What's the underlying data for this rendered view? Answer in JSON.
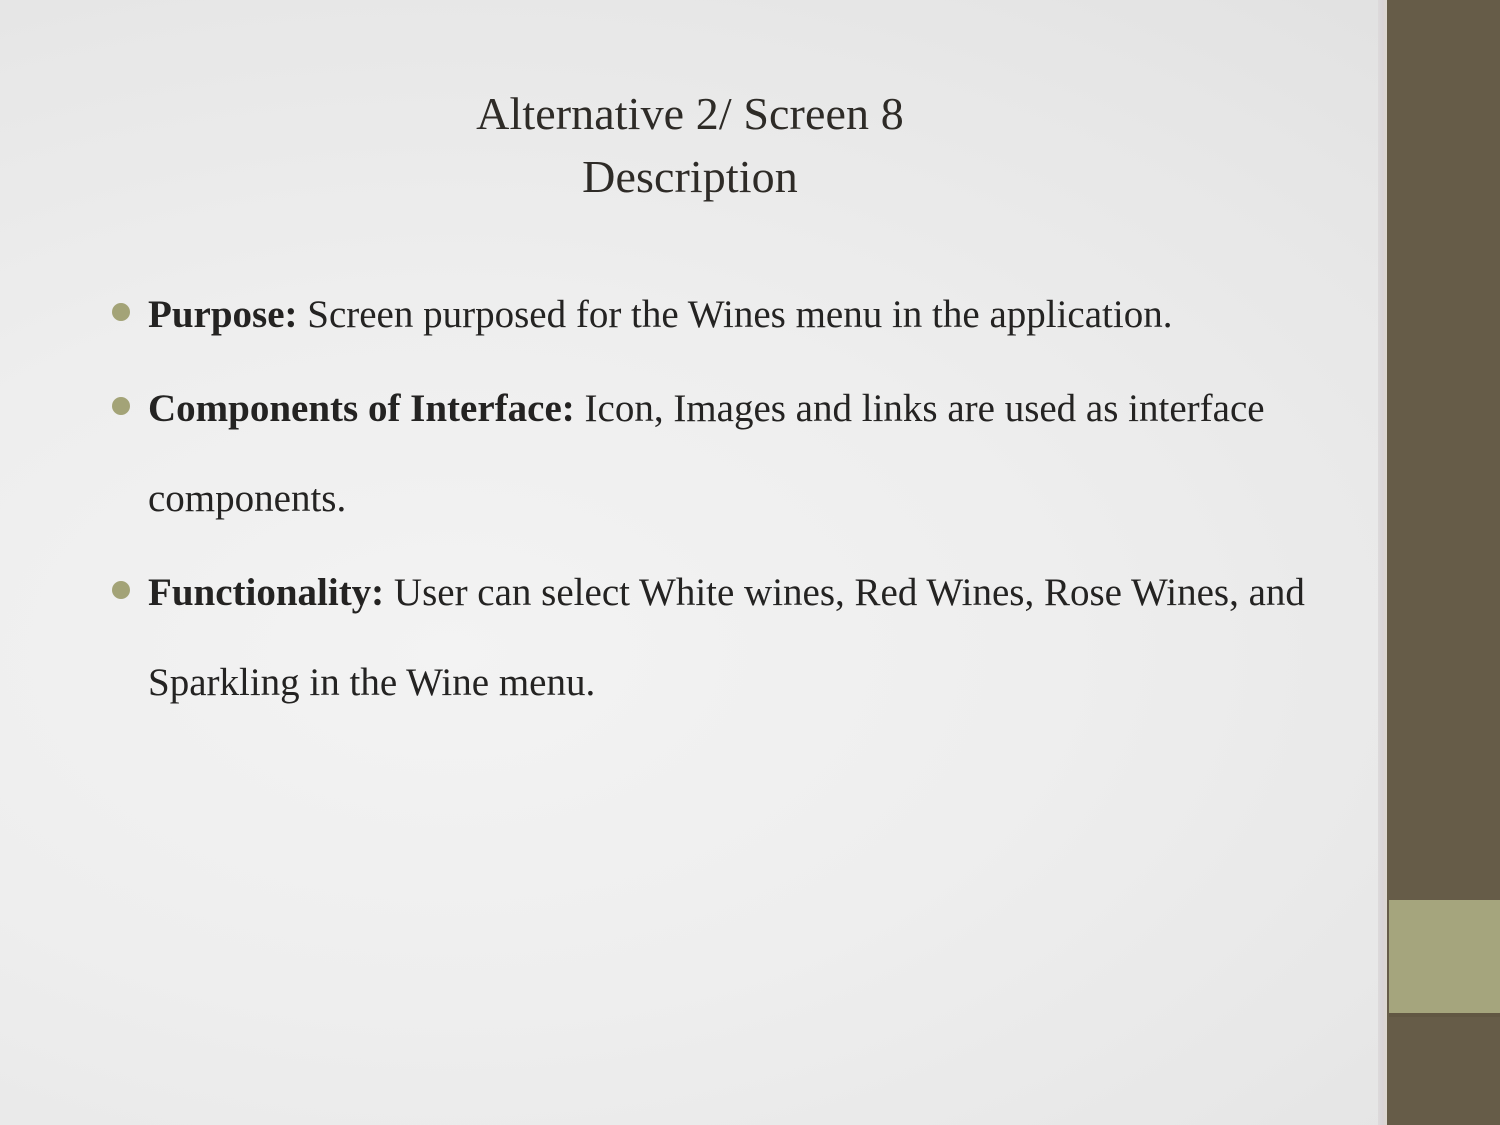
{
  "slide": {
    "title_line1": "Alternative 2/ Screen 8",
    "title_line2": "Description",
    "bullets": [
      {
        "lead": "Purpose:",
        "body": " Screen purposed for the Wines menu in the application.",
        "bullet_icon": "bullet-dot-icon"
      },
      {
        "lead": " Components of Interface:",
        "body": " Icon, Images and links are used as interface components.",
        "bullet_icon": "bullet-dot-icon"
      },
      {
        "lead": "Functionality:",
        "body": " User can select White wines, Red Wines, Rose Wines, and Sparkling in the Wine  menu.",
        "bullet_icon": "bullet-dot-icon"
      }
    ]
  },
  "colors": {
    "background_light": "#f1f1f1",
    "background_edge": "#e2e2e2",
    "band_dark_brown": "#665c48",
    "band_olive": "#a5a57d",
    "bullet_dot": "#a3a377",
    "title_text": "#2e2b27",
    "body_text": "#242322"
  }
}
